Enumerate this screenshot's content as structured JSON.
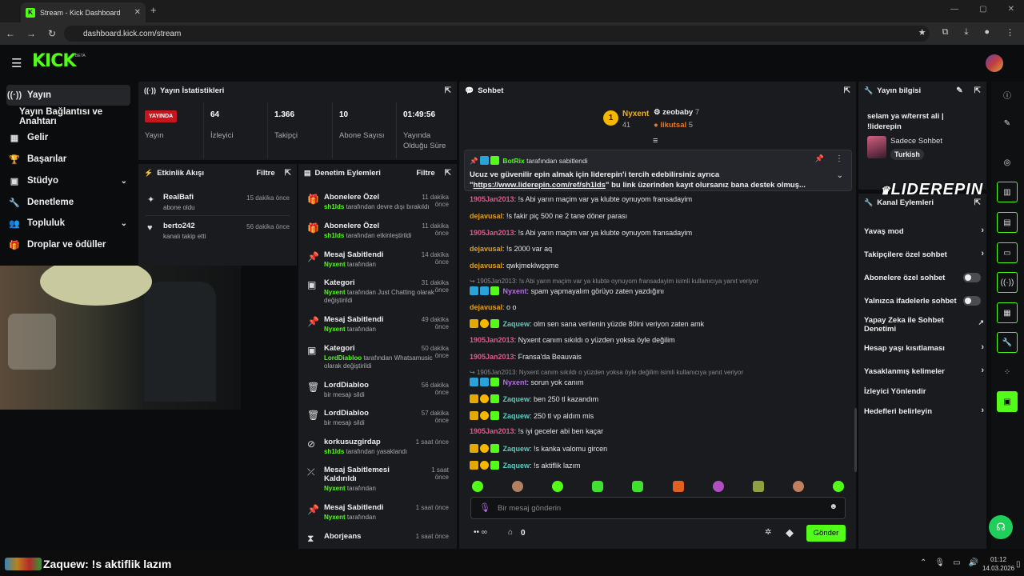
{
  "browser": {
    "tab_title": "Stream - Kick Dashboard",
    "url": "dashboard.kick.com/stream"
  },
  "header": {
    "logo": "KICK",
    "beta": "BETA"
  },
  "sidebar": {
    "items": [
      {
        "label": "Yayın",
        "icon": "broadcast-icon"
      },
      {
        "label": "Yayın Bağlantısı ve Anahtarı",
        "icon": ""
      },
      {
        "label": "Gelir",
        "icon": "revenue-icon"
      },
      {
        "label": "Başarılar",
        "icon": "trophy-icon"
      },
      {
        "label": "Stüdyo",
        "icon": "studio-icon"
      },
      {
        "label": "Denetleme",
        "icon": "wrench-icon"
      },
      {
        "label": "Topluluk",
        "icon": "community-icon"
      },
      {
        "label": "Droplar ve ödüller",
        "icon": "gift-icon"
      }
    ]
  },
  "stats": {
    "title": "Yayın İstatistikleri",
    "live_badge": "YAYINDA",
    "live_label": "Yayın",
    "items": [
      {
        "value": "64",
        "label": "İzleyici"
      },
      {
        "value": "1.366",
        "label": "Takipçi"
      },
      {
        "value": "10",
        "label": "Abone Sayısı"
      },
      {
        "value": "01:49:56",
        "label": "Yayında Olduğu Süre"
      }
    ]
  },
  "activity": {
    "title": "Etkinlik Akışı",
    "filter": "Filtre",
    "items": [
      {
        "name": "RealBafi",
        "desc": "abone oldu",
        "time": "15 dakika önce"
      },
      {
        "name": "berto242",
        "desc": "kanalı takip etti",
        "time": "56 dakika önce"
      }
    ]
  },
  "moderation": {
    "title": "Denetim Eylemleri",
    "filter": "Filtre",
    "items": [
      {
        "title": "Abonelere Özel",
        "user": "sh1lds",
        "rest": " tarafından devre dışı bırakıldı",
        "time": "11 dakika önce"
      },
      {
        "title": "Abonelere Özel",
        "user": "sh1lds",
        "rest": " tarafından etkinleştirildi",
        "time": "11 dakika önce"
      },
      {
        "title": "Mesaj Sabitlendi",
        "user": "Nyxent",
        "rest": " tarafından",
        "time": "14 dakika önce"
      },
      {
        "title": "Kategori",
        "user": "Nyxent",
        "rest": " tarafından Just Chatting olarak değiştirildi",
        "time": "31 dakika önce"
      },
      {
        "title": "Mesaj Sabitlendi",
        "user": "Nyxent",
        "rest": " tarafından",
        "time": "49 dakika önce"
      },
      {
        "title": "Kategori",
        "user": "LordDiabloo",
        "rest": " tarafından Whatsamusic olarak değiştirildi",
        "time": "50 dakika önce"
      },
      {
        "title": "LordDiabloo",
        "user": "",
        "rest": "bir mesajı sildi",
        "time": "56 dakika önce"
      },
      {
        "title": "LordDiabloo",
        "user": "",
        "rest": "bir mesajı sildi",
        "time": "57 dakika önce"
      },
      {
        "title": "korkusuzgirdap",
        "user": "sh1lds",
        "rest": " tarafından yasaklandı",
        "time": "1 saat önce"
      },
      {
        "title": "Mesaj Sabitlemesi Kaldırıldı",
        "user": "Nyxent",
        "rest": " tarafından",
        "time": "1 saat önce"
      },
      {
        "title": "Mesaj Sabitlendi",
        "user": "Nyxent",
        "rest": " tarafından",
        "time": "1 saat önce"
      },
      {
        "title": "Aborjeans",
        "user": "",
        "rest": "",
        "time": "1 saat önce"
      }
    ]
  },
  "chat": {
    "title": "Sohbet",
    "leaders": {
      "first": "Nyxent",
      "first_count": "41",
      "second": "zeobaby",
      "second_count": "7",
      "third": "likutsal",
      "third_count": "5"
    },
    "pinned": {
      "by": "BotRix",
      "by_suffix": "tarafından sabitlendi",
      "text1": "Ucuz ve güvenilir epin almak için liderepin'i tercih edebilirsiniz ayrıca",
      "link": "https://www.liderepin.com/ref/sh1lds",
      "text2": "bu link üzerinden kayıt olursanız bana destek olmuş..."
    },
    "messages": [
      {
        "user": "1905Jan2013",
        "color": "#e05a8a",
        "text": "!s Abi yarın maçim var ya klubte oynuyom fransadayim"
      },
      {
        "user": "dejavusal",
        "color": "#e0a020",
        "text": "!s fakir piç 500 ne 2 tane döner parası"
      },
      {
        "user": "1905Jan2013",
        "color": "#e05a8a",
        "text": "!s Abi yarın maçim var ya klubte oynuyom fransadayim"
      },
      {
        "user": "dejavusal",
        "color": "#e0a020",
        "text": "!s 2000 var aq"
      },
      {
        "user": "dejavusal",
        "color": "#e0a020",
        "text": "qwkjmeklwşqme"
      },
      {
        "reply": "1905Jan2013: !s Abi yarın maçim var ya klubte oynuyom fransadayim isimli kullanıcıya yanıt veriyor",
        "user": "Nyxent",
        "color": "#b070e0",
        "text": "spam yapmayalım görüyo zaten yazdığını"
      },
      {
        "user": "dejavusal",
        "color": "#e0a020",
        "text": "o o"
      },
      {
        "user": "Zaquew",
        "color": "#53d0c0",
        "text": "olm sen sana verilenin yüzde 80ini veriyon zaten amk"
      },
      {
        "user": "1905Jan2013",
        "color": "#e05a8a",
        "text": "Nyxent canım sıkıldı o yüzden yoksa öyle değilim"
      },
      {
        "user": "1905Jan2013",
        "color": "#e05a8a",
        "text": "Fransa'da Beauvais"
      },
      {
        "reply": "1905Jan2013: Nyxent canım sıkıldı o yüzden yoksa öyle değilim isimli kullanıcıya yanıt veriyor",
        "user": "Nyxent",
        "color": "#b070e0",
        "text": "sorun yok canım"
      },
      {
        "user": "Zaquew",
        "color": "#53d0c0",
        "text": "ben 250 tl kazandım"
      },
      {
        "user": "Zaquew",
        "color": "#53d0c0",
        "text": "250 tl vp aldım mis"
      },
      {
        "user": "1905Jan2013",
        "color": "#e05a8a",
        "text": "!s iyi geceler abi ben kaçar"
      },
      {
        "user": "Zaquew",
        "color": "#53d0c0",
        "text": "!s kanka valomu gircen"
      },
      {
        "user": "Zaquew",
        "color": "#53d0c0",
        "text": "!s aktiflik lazım"
      }
    ],
    "input_placeholder": "Bir mesaj gönderin",
    "points": "0",
    "send": "Gönder"
  },
  "info": {
    "title": "Yayın bilgisi",
    "stream_title": "selam ya w/terrst ali | !liderepin",
    "chat_mode": "Sadece Sohbet",
    "language": "Turkish"
  },
  "overlay_logo": "LIDEREPIN",
  "channel": {
    "title": "Kanal Eylemleri",
    "options": [
      {
        "label": "Yavaş mod",
        "kind": "arrow"
      },
      {
        "label": "Takipçilere özel sohbet",
        "kind": "arrow"
      },
      {
        "label": "Abonelere özel sohbet",
        "kind": "toggle"
      },
      {
        "label": "Yalnızca ifadelerle sohbet",
        "kind": "toggle"
      },
      {
        "label": "Yapay Zeka ile Sohbet Denetimi",
        "kind": "link"
      },
      {
        "label": "Hesap yaşı kısıtlaması",
        "kind": "arrow"
      },
      {
        "label": "Yasaklanmış kelimeler",
        "kind": "arrow"
      },
      {
        "label": "İzleyici Yönlendir",
        "kind": "none"
      },
      {
        "label": "Hedefleri belirleyin",
        "kind": "arrow"
      }
    ]
  },
  "taskbar": {
    "ticker_user": "Zaquew",
    "ticker_text": ": !s aktiflik lazım",
    "time": "01:12",
    "date": "14.03.2026"
  }
}
